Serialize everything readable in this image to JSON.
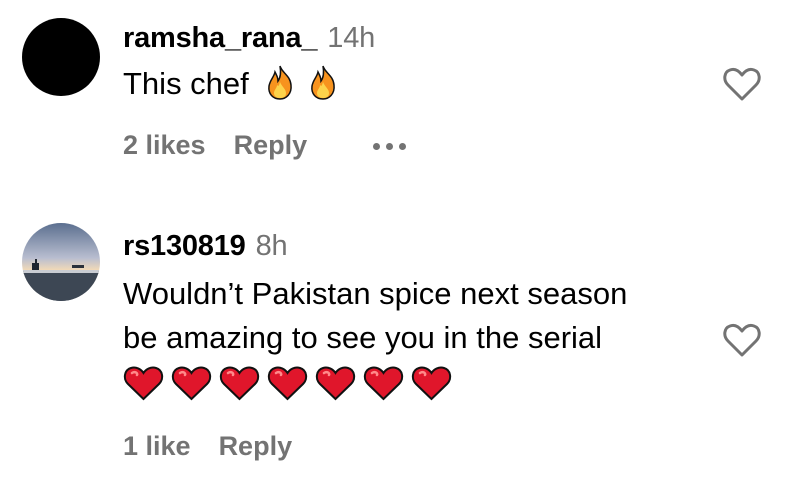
{
  "comments": [
    {
      "username": "ramsha_rana_",
      "time": "14h",
      "text": "This chef",
      "emoji": [
        "fire",
        "fire"
      ],
      "likes": "2 likes",
      "reply": "Reply",
      "avatar": "black-circle"
    },
    {
      "username": "rs130819",
      "time": "8h",
      "text_lines": [
        "Wouldn’t Pakistan spice next season",
        "be amazing to see you in the serial"
      ],
      "emoji": [
        "red-heart",
        "red-heart",
        "red-heart",
        "red-heart",
        "red-heart",
        "red-heart",
        "red-heart"
      ],
      "likes": "1 like",
      "reply": "Reply",
      "avatar": "seaside-sunset-photo"
    }
  ],
  "colors": {
    "secondary_text": "#737373",
    "heart_red": "#e0162b",
    "fire_orange": "#f7931e"
  }
}
